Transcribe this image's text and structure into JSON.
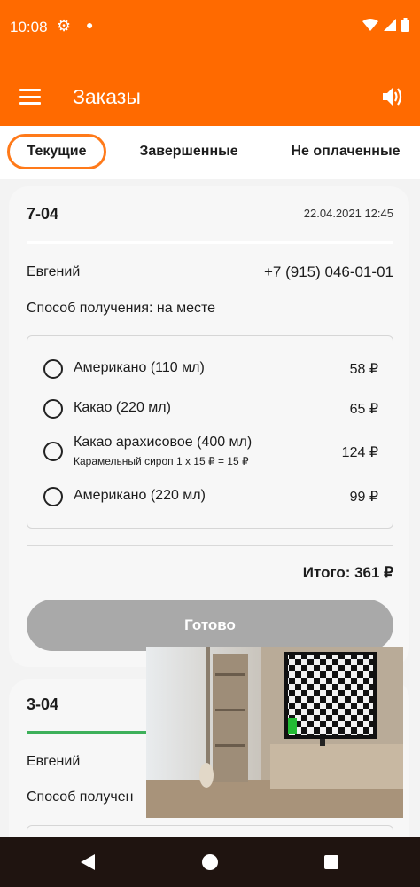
{
  "status_bar": {
    "time": "10:08"
  },
  "app_bar": {
    "title": "Заказы"
  },
  "tabs": [
    {
      "label": "Текущие",
      "active": true
    },
    {
      "label": "Завершенные",
      "active": false
    },
    {
      "label": "Не оплаченные",
      "active": false
    }
  ],
  "orders": [
    {
      "number": "7-04",
      "date": "22.04.2021 12:45",
      "progress": 0.0,
      "customer": "Евгений",
      "phone": "+7 (915) 046-01-01",
      "delivery": "Способ получения: на месте",
      "items": [
        {
          "name": "Американо (110 мл)",
          "price": "58 ₽"
        },
        {
          "name": "Какао (220 мл)",
          "price": "65 ₽"
        },
        {
          "name": "Какао арахисовое (400 мл)",
          "extra": "Карамельный сироп 1 x 15 ₽ = 15 ₽",
          "price": "124 ₽"
        },
        {
          "name": "Американо (220 мл)",
          "price": "99 ₽"
        }
      ],
      "total": "Итого: 361 ₽",
      "button": "Готово"
    },
    {
      "number": "3-04",
      "progress": 0.33,
      "customer": "Евгений",
      "delivery": "Способ получен"
    }
  ],
  "colors": {
    "accent": "#ff6a00",
    "progress": "#3db05a",
    "button_disabled": "#a9a9a9"
  }
}
